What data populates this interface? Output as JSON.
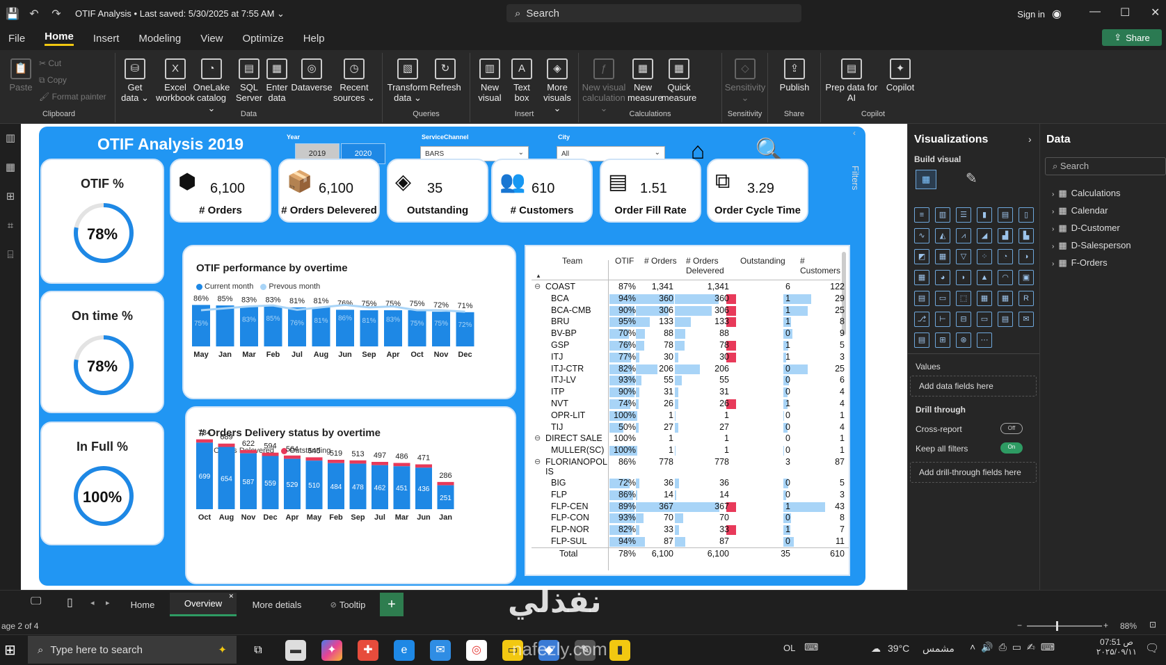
{
  "app": {
    "title": "OTIF Analysis",
    "saved": "•  Last saved: 5/30/2025 at 7:55 AM",
    "search": "Search",
    "signin": "Sign in",
    "share": "Share"
  },
  "menu": [
    "File",
    "Home",
    "Insert",
    "Modeling",
    "View",
    "Optimize",
    "Help"
  ],
  "ribbon": {
    "clipboard": {
      "paste": "Paste",
      "cut": "Cut",
      "copy": "Copy",
      "format_painter": "Format painter",
      "label": "Clipboard"
    },
    "data": {
      "label": "Data",
      "buttons": [
        {
          "l1": "Get",
          "l2": "data ⌄",
          "icon": "⛁"
        },
        {
          "l1": "Excel",
          "l2": "workbook",
          "icon": "X"
        },
        {
          "l1": "OneLake",
          "l2": "catalog ⌄",
          "icon": "◔"
        },
        {
          "l1": "SQL",
          "l2": "Server",
          "icon": "▤"
        },
        {
          "l1": "Enter",
          "l2": "data",
          "icon": "▦"
        },
        {
          "l1": "Dataverse",
          "l2": "",
          "icon": "◎"
        },
        {
          "l1": "Recent",
          "l2": "sources ⌄",
          "icon": "◷"
        }
      ]
    },
    "queries": {
      "label": "Queries",
      "buttons": [
        {
          "l1": "Transform",
          "l2": "data ⌄",
          "icon": "▧"
        },
        {
          "l1": "Refresh",
          "l2": "",
          "icon": "↻"
        }
      ]
    },
    "insert": {
      "label": "Insert",
      "buttons": [
        {
          "l1": "New",
          "l2": "visual",
          "icon": "▥"
        },
        {
          "l1": "Text",
          "l2": "box",
          "icon": "A"
        },
        {
          "l1": "More",
          "l2": "visuals ⌄",
          "icon": "◈"
        }
      ]
    },
    "calculations": {
      "label": "Calculations",
      "buttons": [
        {
          "l1": "New visual",
          "l2": "calculation ⌄",
          "icon": "ƒ"
        },
        {
          "l1": "New",
          "l2": "measure",
          "icon": "▦"
        },
        {
          "l1": "Quick",
          "l2": "measure",
          "icon": "▦"
        }
      ]
    },
    "sensitivity": {
      "label": "Sensitivity",
      "buttons": [
        {
          "l1": "Sensitivity",
          "l2": "⌄",
          "icon": "◇"
        }
      ]
    },
    "share": {
      "label": "Share",
      "buttons": [
        {
          "l1": "Publish",
          "l2": "",
          "icon": "⇪"
        }
      ]
    },
    "copilot": {
      "label": "Copilot",
      "buttons": [
        {
          "l1": "Prep data for",
          "l2": "AI",
          "icon": "▤"
        },
        {
          "l1": "Copilot",
          "l2": "",
          "icon": "✦"
        }
      ]
    }
  },
  "report": {
    "title": "OTIF Analysis 2019",
    "year_label": "Year",
    "years": [
      "2019",
      "2020"
    ],
    "service_label": "ServiceChannel",
    "service_value": "BARS",
    "city_label": "City",
    "city_value": "All"
  },
  "gauges": [
    {
      "title": "OTIF %",
      "value": "78%",
      "fraction": 0.78
    },
    {
      "title": "On time %",
      "value": "78%",
      "fraction": 0.78
    },
    {
      "title": "In Full %",
      "value": "100%",
      "fraction": 1.0
    }
  ],
  "kpis": [
    {
      "value": "6,100",
      "label": "# Orders",
      "icon": "box-icon"
    },
    {
      "value": "6,100",
      "label": "# Orders Delevered",
      "icon": "delivery-box-icon"
    },
    {
      "value": "35",
      "label": "Outstanding",
      "icon": "dropbox-icon"
    },
    {
      "value": "610",
      "label": "# Customers",
      "icon": "customers-icon"
    },
    {
      "value": "1.51",
      "label": "Order Fill Rate",
      "icon": "documents-icon"
    },
    {
      "value": "3.29",
      "label": "Order Cycle Time",
      "icon": "copy-icon"
    }
  ],
  "chart_data": [
    {
      "type": "bar",
      "title": "OTIF performance by overtime",
      "categories": [
        "May",
        "Jan",
        "Mar",
        "Feb",
        "Jul",
        "Aug",
        "Jun",
        "Sep",
        "Apr",
        "Oct",
        "Nov",
        "Dec"
      ],
      "series": [
        {
          "name": "Current month",
          "values": [
            86,
            85,
            83,
            83,
            81,
            81,
            76,
            75,
            75,
            75,
            72,
            71
          ],
          "labels": [
            "86%",
            "85%",
            "83%",
            "83%",
            "81%",
            "81%",
            "76%",
            "75%",
            "75%",
            "75%",
            "72%",
            "71%"
          ]
        },
        {
          "name": "Prevous month",
          "values": [
            75,
            null,
            83,
            85,
            76,
            81,
            86,
            81,
            83,
            75,
            75,
            72
          ],
          "labels": [
            "75%",
            "",
            "83%",
            "85%",
            "76%",
            "81%",
            "86%",
            "81%",
            "83%",
            "75%",
            "75%",
            "72%"
          ]
        }
      ],
      "ylim": [
        0,
        100
      ],
      "colors": {
        "current": "#1e88e5",
        "previous": "#a8d4f7"
      }
    },
    {
      "type": "bar",
      "title": "# Orders Delivery status by overtime",
      "categories": [
        "Oct",
        "Aug",
        "Nov",
        "Dec",
        "Apr",
        "May",
        "Feb",
        "Sep",
        "Jul",
        "Mar",
        "Jun",
        "Jan"
      ],
      "series": [
        {
          "name": "# Orders Delevered",
          "values": [
            699,
            654,
            587,
            559,
            529,
            510,
            484,
            478,
            462,
            451,
            436,
            251
          ]
        },
        {
          "name": "Outstanding",
          "values": [
            35,
            35,
            35,
            35,
            35,
            35,
            35,
            35,
            35,
            35,
            35,
            35
          ]
        }
      ],
      "totals": [
        734,
        689,
        622,
        594,
        564,
        545,
        519,
        513,
        497,
        486,
        471,
        286
      ],
      "ylim": [
        0,
        760
      ],
      "colors": {
        "delivered": "#1e88e5",
        "outstanding": "#e83a5a"
      }
    },
    {
      "type": "table",
      "columns": [
        "Team",
        "OTIF",
        "# Orders",
        "# Orders Delivered",
        "Outstanding",
        "# Customers"
      ],
      "rows": [
        {
          "team": "COAST",
          "otif": "87%",
          "orders": "1,341",
          "delivered": "1,341",
          "out": "6",
          "cust": "122",
          "group": true,
          "sym": "⊖"
        },
        {
          "team": "BCA",
          "otif": "94%",
          "o": 94,
          "orders": "360",
          "ov": 360,
          "delivered": "360",
          "out": "1",
          "outv": 1,
          "cust": "29",
          "cv": 29
        },
        {
          "team": "BCA-CMB",
          "otif": "90%",
          "o": 90,
          "orders": "306",
          "ov": 306,
          "delivered": "306",
          "out": "1",
          "outv": 1,
          "cust": "25",
          "cv": 25
        },
        {
          "team": "BRU",
          "otif": "95%",
          "o": 95,
          "orders": "133",
          "ov": 133,
          "delivered": "133",
          "out": "1",
          "outv": 1,
          "cust": "8",
          "cv": 8
        },
        {
          "team": "BV-BP",
          "otif": "70%",
          "o": 70,
          "orders": "88",
          "ov": 88,
          "delivered": "88",
          "out": "0",
          "outv": 0,
          "cust": "9",
          "cv": 9
        },
        {
          "team": "GSP",
          "otif": "76%",
          "o": 76,
          "orders": "78",
          "ov": 78,
          "delivered": "78",
          "out": "1",
          "outv": 1,
          "cust": "5",
          "cv": 5
        },
        {
          "team": "ITJ",
          "otif": "77%",
          "o": 77,
          "orders": "30",
          "ov": 30,
          "delivered": "30",
          "out": "1",
          "outv": 1,
          "cust": "3",
          "cv": 3
        },
        {
          "team": "ITJ-CTR",
          "otif": "82%",
          "o": 82,
          "orders": "206",
          "ov": 206,
          "delivered": "206",
          "out": "0",
          "outv": 0,
          "cust": "25",
          "cv": 25
        },
        {
          "team": "ITJ-LV",
          "otif": "93%",
          "o": 93,
          "orders": "55",
          "ov": 55,
          "delivered": "55",
          "out": "0",
          "outv": 0,
          "cust": "6",
          "cv": 6
        },
        {
          "team": "ITP",
          "otif": "90%",
          "o": 90,
          "orders": "31",
          "ov": 31,
          "delivered": "31",
          "out": "0",
          "outv": 0,
          "cust": "4",
          "cv": 4
        },
        {
          "team": "NVT",
          "otif": "74%",
          "o": 74,
          "orders": "26",
          "ov": 26,
          "delivered": "26",
          "out": "1",
          "outv": 1,
          "cust": "4",
          "cv": 4
        },
        {
          "team": "OPR-LIT",
          "otif": "100%",
          "o": 100,
          "orders": "1",
          "ov": 1,
          "delivered": "1",
          "out": "0",
          "outv": 0,
          "cust": "1",
          "cv": 1
        },
        {
          "team": "TIJ",
          "otif": "50%",
          "o": 50,
          "orders": "27",
          "ov": 27,
          "delivered": "27",
          "out": "0",
          "outv": 0,
          "cust": "4",
          "cv": 4
        },
        {
          "team": "DIRECT SALE",
          "otif": "100%",
          "orders": "1",
          "delivered": "1",
          "out": "0",
          "cust": "1",
          "group": true,
          "sym": "⊖"
        },
        {
          "team": "MULLER(SC)",
          "otif": "100%",
          "o": 100,
          "orders": "1",
          "ov": 1,
          "delivered": "1",
          "out": "0",
          "outv": 0,
          "cust": "1",
          "cv": 1
        },
        {
          "team": "FLORIANOPOL",
          "team2": "IS",
          "otif": "86%",
          "orders": "778",
          "delivered": "778",
          "out": "3",
          "cust": "87",
          "group": true,
          "sym": "⊖",
          "tall": true
        },
        {
          "team": "BIG",
          "otif": "72%",
          "o": 72,
          "orders": "36",
          "ov": 36,
          "delivered": "36",
          "out": "0",
          "outv": 0,
          "cust": "5",
          "cv": 5
        },
        {
          "team": "FLP",
          "otif": "86%",
          "o": 86,
          "orders": "14",
          "ov": 14,
          "delivered": "14",
          "out": "0",
          "outv": 0,
          "cust": "3",
          "cv": 3
        },
        {
          "team": "FLP-CEN",
          "otif": "89%",
          "o": 89,
          "orders": "367",
          "ov": 367,
          "delivered": "367",
          "out": "1",
          "outv": 1,
          "cust": "43",
          "cv": 43
        },
        {
          "team": "FLP-CON",
          "otif": "93%",
          "o": 93,
          "orders": "70",
          "ov": 70,
          "delivered": "70",
          "out": "0",
          "outv": 0,
          "cust": "8",
          "cv": 8
        },
        {
          "team": "FLP-NOR",
          "otif": "82%",
          "o": 82,
          "orders": "33",
          "ov": 33,
          "delivered": "33",
          "out": "1",
          "outv": 1,
          "cust": "7",
          "cv": 7
        },
        {
          "team": "FLP-SUL",
          "otif": "94%",
          "o": 94,
          "orders": "87",
          "ov": 87,
          "delivered": "87",
          "out": "0",
          "outv": 0,
          "cust": "11",
          "cv": 11
        },
        {
          "team": "Total",
          "otif": "78%",
          "orders": "6,100",
          "delivered": "6,100",
          "out": "35",
          "cust": "610",
          "total": true
        }
      ]
    }
  ],
  "table_headers": {
    "team": "Team",
    "otif": "OTIF",
    "orders": "# Orders",
    "del1": "# Orders",
    "del2": "Delevered",
    "out": "Outstanding",
    "cust1": "#",
    "cust2": "Customers"
  },
  "viz": {
    "title": "Visualizations",
    "build": "Build visual",
    "values": "Values",
    "add_fields": "Add data fields here",
    "drill": "Drill through",
    "cross": "Cross-report",
    "cross_state": "Off",
    "keep": "Keep all filters",
    "keep_state": "On",
    "add_drill": "Add drill-through fields here",
    "filters": "Filters"
  },
  "data_pane": {
    "title": "Data",
    "search": "Search",
    "tables": [
      "Calculations",
      "Calendar",
      "D-Customer",
      "D-Salesperson",
      "F-Orders"
    ]
  },
  "tabs": [
    "Home",
    "Overview",
    "More detials",
    "Tooltip"
  ],
  "status": {
    "page": "age 2 of 4",
    "zoom": "88%"
  },
  "taskbar": {
    "search": "Type here to search",
    "lang": "OL",
    "temp": "39°C",
    "weather": "مشمس",
    "time": "07:51 ص",
    "date": "۲۰۲۵/۰۹/۱۱"
  },
  "watermark": {
    "logo": "نفذلي",
    "site": "nafezly.com"
  }
}
